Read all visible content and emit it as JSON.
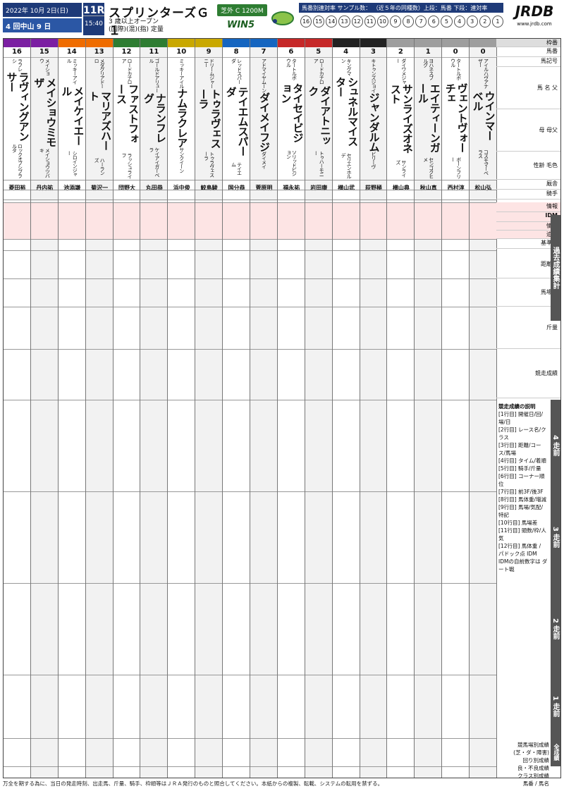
{
  "header": {
    "date": "2022年 10月 2日(日)",
    "meeting": "4 回中山 9 日",
    "race_no": "11R",
    "post_time": "15:40",
    "race_name": "スプリンターズＧ１",
    "conditions_1": "3 歳以上オープン",
    "conditions_2": "(国際)(混)(指) 定量",
    "course": "芝外 C 1200M",
    "win5": "WIN5",
    "sample_label": "馬番別連対率 サンプル数：",
    "sample_note": "（近５年の同種数）上段：馬番 下段：連対率",
    "sample_nums": [
      "16",
      "15",
      "14",
      "13",
      "12",
      "11",
      "10",
      "9",
      "8",
      "7",
      "6",
      "5",
      "4",
      "3",
      "2",
      "1"
    ],
    "logo": "JRDB",
    "logo_url": "www.jrdb.com"
  },
  "horses": [
    {
      "no": "16",
      "name": "ラヴィングアンサー",
      "sire": "ラフレシ",
      "dam": "ロックオブシブラルタ",
      "jockey": "菱田裕"
    },
    {
      "no": "15",
      "name": "メイショウミモザ",
      "sire": "メイショウ",
      "dam": "メイショウツバキ",
      "jockey": "丹内祐"
    },
    {
      "no": "14",
      "name": "メイケイエール",
      "sire": "ミッキーアイル",
      "dam": "シロインジャー",
      "jockey": "池添謙"
    },
    {
      "no": "13",
      "name": "マリアズハート",
      "sire": "メダグリアドーロ",
      "dam": "ハーランズ",
      "jockey": "菊沢一"
    },
    {
      "no": "12",
      "name": "ファストフォース",
      "sire": "ロードカナロア",
      "dam": "ラッシュライフ",
      "jockey": "団野大"
    },
    {
      "no": "11",
      "name": "ナランフレグ",
      "sire": "ゴールドアリュール",
      "dam": "ケイアイガーベラ",
      "jockey": "丸田恭"
    },
    {
      "no": "10",
      "name": "ナムラクレア",
      "sire": "ミッキーアイル",
      "dam": "サンクイーン",
      "jockey": "浜中俊"
    },
    {
      "no": "9",
      "name": "トゥラヴェスーラ",
      "sire": "ドリームジャーニー",
      "dam": "トゥラヴェスーラ",
      "jockey": "鮫島駿"
    },
    {
      "no": "8",
      "name": "テイエムスパーダ",
      "sire": "レッドスパーダ",
      "dam": "テイエム",
      "jockey": "国分恭"
    },
    {
      "no": "7",
      "name": "ダイメイフジ",
      "sire": "アドマイヤムーン",
      "dam": "ダイメイ",
      "jockey": "菅原明"
    },
    {
      "no": "6",
      "name": "タイセイビジョン",
      "sire": "タートルボウル",
      "dam": "ソリッドビジョン",
      "jockey": "福永祐"
    },
    {
      "no": "5",
      "name": "ダイアトニック",
      "sire": "ロードカナロア",
      "dam": "トゥハーモニー",
      "jockey": "岩田康"
    },
    {
      "no": "4",
      "name": "シュネルマイスター",
      "sire": "キングマン",
      "dam": "セリエンホルデ",
      "jockey": "横山武"
    },
    {
      "no": "3",
      "name": "ジャンダルム",
      "sire": "キトゥンズジョイ",
      "dam": "ビリーヴ",
      "jockey": "荻野極"
    },
    {
      "no": "2",
      "name": "サンライズオネスト",
      "sire": "ダイワメジャー",
      "dam": "サンライズ",
      "jockey": "横山典"
    },
    {
      "no": "1",
      "name": "エイティーンガール",
      "sire": "ヨハネスブルグ",
      "dam": "センゴクヒメ",
      "jockey": "秋山真"
    },
    {
      "no": "0",
      "name": "ヴェントヴォーチェ",
      "sire": "タートルボウル",
      "dam": "ボーンフリー",
      "jockey": "西村淳"
    },
    {
      "no": "0",
      "name": "ウインマーベル",
      "sire": "アイルハヴアナザー",
      "dam": "コスモマーベラス",
      "jockey": "松山弘"
    }
  ],
  "side": {
    "rows": [
      "枠番",
      "馬番",
      "馬記号",
      "馬 名 父",
      "母 母父",
      "性齢 毛色",
      "厩舎",
      "騎手",
      "情報",
      "IDM",
      "情報",
      "追切",
      "基準値",
      "距離別",
      "馬場別",
      "斤量",
      "競走成績",
      "2 走前",
      "1 走前",
      "前走"
    ],
    "tab1": "過去成績集計",
    "tab2": "4 走前",
    "tab3": "3 走前",
    "tab4": "2 走前",
    "tab5": "1 走前",
    "tab6": "全成績",
    "legend": [
      "競走成績の説明",
      "[1行目] 開催日/回/場/日",
      "[2行目] レース名/クラス",
      "[3行目] 距離/コース/馬場",
      "[4行目] タイム/着順",
      "[5行目] 騎手/斤量",
      "[6行目] コーナー順位",
      "[7行目] 前3F/後3F",
      "[8行目] 馬体重/増減",
      "[9行目] 馬場/気配/特記",
      "[10行目] 馬場差",
      "[11行目] 頭数/枠/人気",
      "[12行目] 馬体重 / パドック点 IDM",
      "IDMの自前数字は ダート戦"
    ],
    "footer": [
      "競馬場別成績",
      "(芝・ダ・障害)",
      "回り別成績",
      "良・不良成績",
      "クラス別成績",
      "馬番 / 馬名"
    ]
  },
  "note": "万全を期する為に、当日の発走時刻、出走馬、斤量、騎手、枠順等はＪＲＡ発行のものと照合してください。本紙からの複製、転載、システムの転用を禁ずる。"
}
